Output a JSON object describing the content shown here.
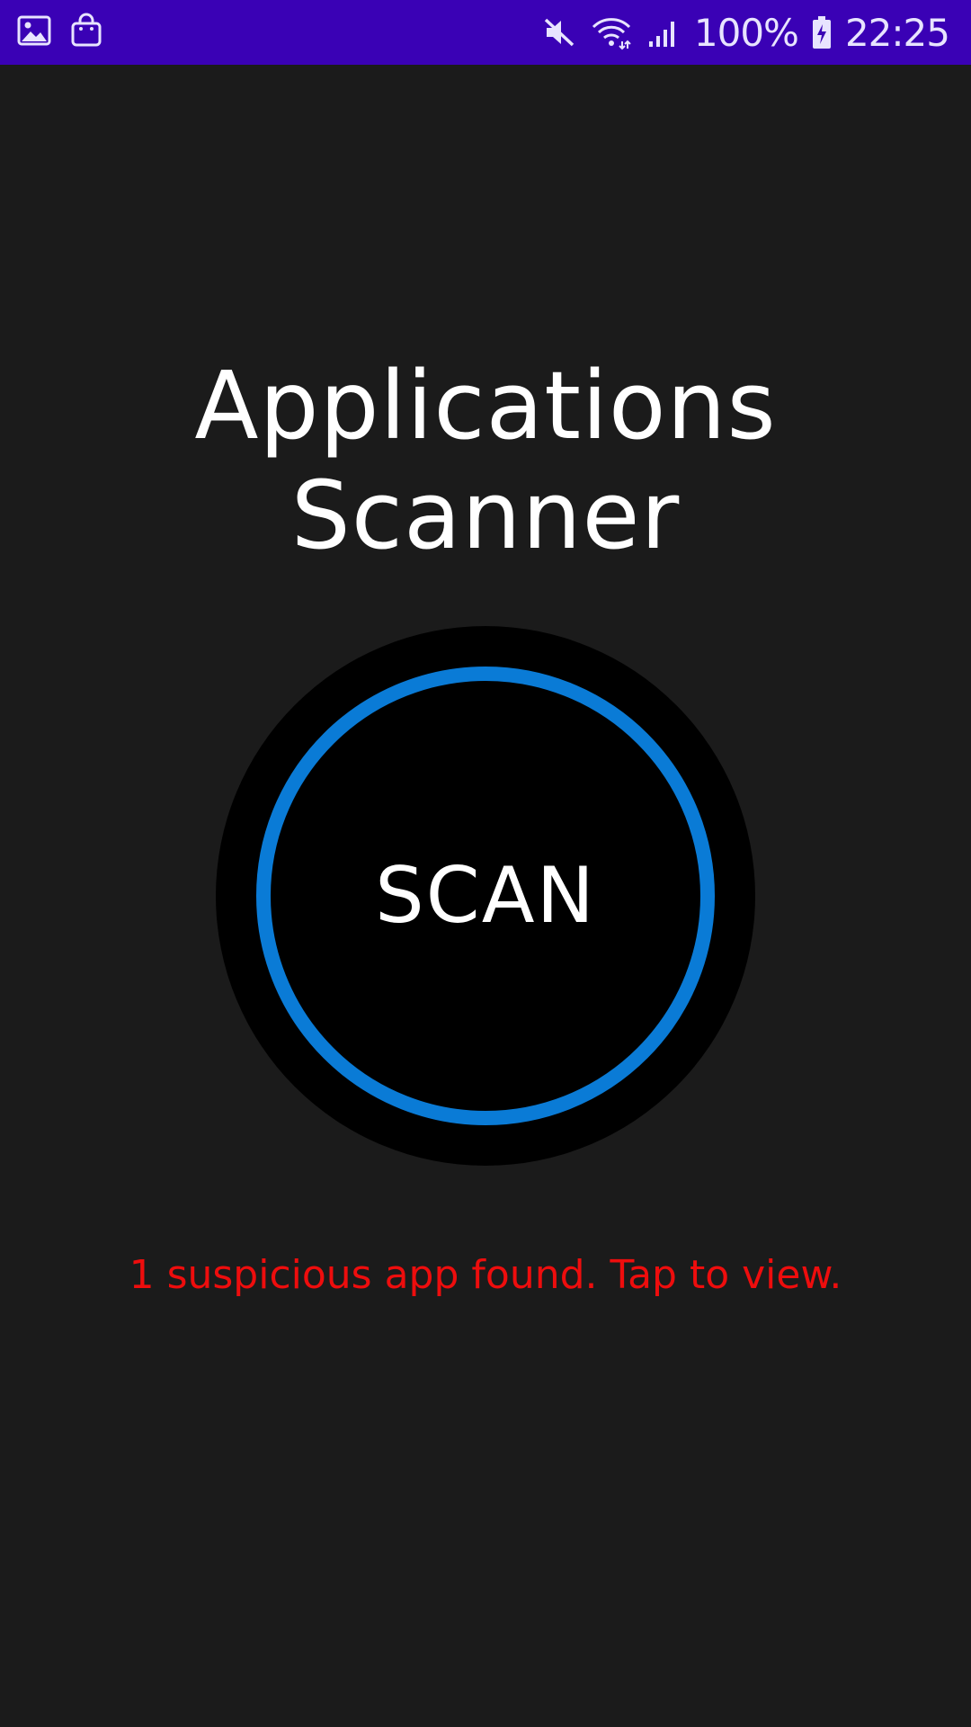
{
  "status_bar": {
    "percent": "100%",
    "time": "22:25",
    "icons": [
      "image-icon",
      "shopping-bag-icon",
      "mute-icon",
      "wifi-icon",
      "signal-icon",
      "battery-charging-icon"
    ],
    "background_color": "#3a01b5"
  },
  "main": {
    "title": "Applications Scanner",
    "scan_button_label": "SCAN",
    "result_message": "1 suspicious app found. Tap to view."
  },
  "colors": {
    "background": "#1b1b1b",
    "ring": "#0a7bd6",
    "alert_text": "#ee0d0d"
  }
}
